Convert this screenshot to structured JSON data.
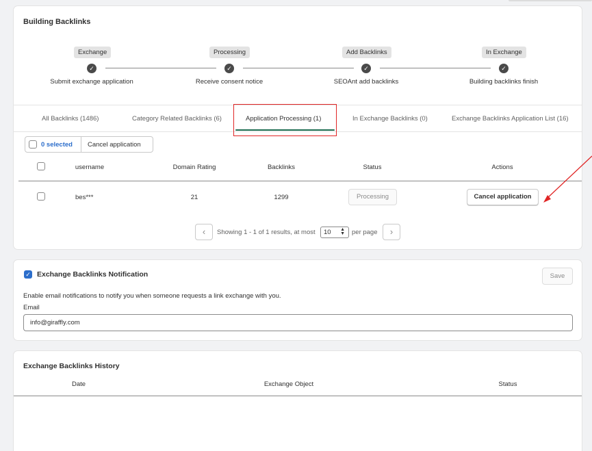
{
  "backlinks_card": {
    "title": "Building Backlinks",
    "steps": [
      {
        "badge": "Exchange",
        "label": "Submit exchange application"
      },
      {
        "badge": "Processing",
        "label": "Receive consent notice"
      },
      {
        "badge": "Add Backlinks",
        "label": "SEOAnt add backlinks"
      },
      {
        "badge": "In Exchange",
        "label": "Building backlinks finish"
      }
    ],
    "tabs": [
      {
        "label": "All Backlinks (1486)"
      },
      {
        "label": "Category Related Backlinks (6)"
      },
      {
        "label": "Application Processing (1)",
        "active": true
      },
      {
        "label": "In Exchange Backlinks (0)"
      },
      {
        "label": "Exchange Backlinks Application List (16)"
      }
    ],
    "selection": {
      "selected_label": "0 selected",
      "bulk_action": "Cancel application"
    },
    "table": {
      "headers": [
        "username",
        "Domain Rating",
        "Backlinks",
        "Status",
        "Actions"
      ],
      "rows": [
        {
          "username": "bes***",
          "domain_rating": "21",
          "backlinks": "1299",
          "status": "Processing",
          "action": "Cancel application"
        }
      ]
    },
    "pagination": {
      "summary": "Showing 1 - 1 of 1 results, at most",
      "per_page_value": "10",
      "per_page_label": "per page"
    }
  },
  "notification_card": {
    "title": "Exchange Backlinks Notification",
    "save_label": "Save",
    "description": "Enable email notifications to notify you when someone requests a link exchange with you.",
    "email_label": "Email",
    "email_value": "info@giraffly.com"
  },
  "history_card": {
    "title": "Exchange Backlinks History",
    "headers": [
      "Date",
      "Exchange Object",
      "Status"
    ]
  },
  "colors": {
    "accent": "#1a6b4f",
    "highlight": "#e02424",
    "checkbox": "#2c6ecb"
  },
  "icons": [
    "check-icon",
    "chevron-left-icon",
    "chevron-right-icon",
    "select-arrows-icon",
    "annotation-arrow"
  ]
}
